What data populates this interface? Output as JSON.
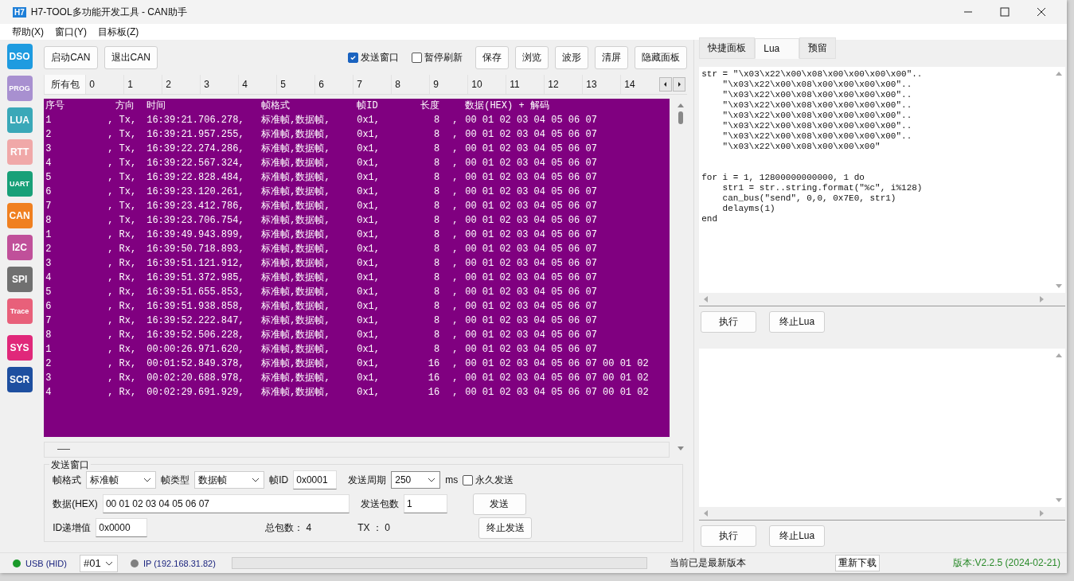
{
  "window": {
    "title": "H7-TOOL多功能开发工具 - CAN助手",
    "logo": "H7"
  },
  "menu": [
    "帮助(X)",
    "窗口(Y)",
    "目标板(Z)"
  ],
  "sidebar": [
    {
      "label": "DSO",
      "color": "#1e9be0"
    },
    {
      "label": "PROG",
      "color": "#a890d0"
    },
    {
      "label": "LUA",
      "color": "#3aa8b8"
    },
    {
      "label": "RTT",
      "color": "#f0a8a8"
    },
    {
      "label": "UART",
      "color": "#18a078"
    },
    {
      "label": "CAN",
      "color": "#f08020"
    },
    {
      "label": "I2C",
      "color": "#c0509a"
    },
    {
      "label": "SPI",
      "color": "#707070"
    },
    {
      "label": "Trace",
      "color": "#e8607a"
    },
    {
      "label": "SYS",
      "color": "#e0287a"
    },
    {
      "label": "SCR",
      "color": "#1e4fa0"
    }
  ],
  "toolbar": {
    "left_buttons": [
      "启动CAN",
      "退出CAN"
    ],
    "checkboxes": [
      {
        "label": "发送窗口",
        "checked": true
      },
      {
        "label": "暂停刷新",
        "checked": false
      }
    ],
    "right_buttons": [
      "保存",
      "浏览",
      "波形",
      "清屏",
      "隐藏面板"
    ]
  },
  "channel_tabs": [
    {
      "label": "所有包",
      "selected": true
    },
    {
      "label": "0",
      "selected": false
    },
    {
      "label": "1",
      "selected": false
    },
    {
      "label": "2",
      "selected": false
    },
    {
      "label": "3",
      "selected": false
    },
    {
      "label": "4",
      "selected": false
    },
    {
      "label": "5",
      "selected": false
    },
    {
      "label": "6",
      "selected": false
    },
    {
      "label": "7",
      "selected": false
    },
    {
      "label": "8",
      "selected": false
    },
    {
      "label": "9",
      "selected": false
    },
    {
      "label": "10",
      "selected": false
    },
    {
      "label": "11",
      "selected": false
    },
    {
      "label": "12",
      "selected": false
    },
    {
      "label": "13",
      "selected": false
    },
    {
      "label": "14",
      "selected": false
    }
  ],
  "log": {
    "columns": [
      "序号",
      "方向",
      "时间",
      "帧格式",
      "帧ID",
      "长度",
      "数据(HEX) + 解码"
    ],
    "rows": [
      {
        "seq": "1",
        "dir": ", Tx,",
        "time": "16:39:21.706.278,",
        "format": "标准帧,数据帧,",
        "id": "0x1,",
        "len": "8",
        "sep": ",",
        "data": "00 01 02 03 04 05 06 07"
      },
      {
        "seq": "2",
        "dir": ", Tx,",
        "time": "16:39:21.957.255,",
        "format": "标准帧,数据帧,",
        "id": "0x1,",
        "len": "8",
        "sep": ",",
        "data": "00 01 02 03 04 05 06 07"
      },
      {
        "seq": "3",
        "dir": ", Tx,",
        "time": "16:39:22.274.286,",
        "format": "标准帧,数据帧,",
        "id": "0x1,",
        "len": "8",
        "sep": ",",
        "data": "00 01 02 03 04 05 06 07"
      },
      {
        "seq": "4",
        "dir": ", Tx,",
        "time": "16:39:22.567.324,",
        "format": "标准帧,数据帧,",
        "id": "0x1,",
        "len": "8",
        "sep": ",",
        "data": "00 01 02 03 04 05 06 07"
      },
      {
        "seq": "5",
        "dir": ", Tx,",
        "time": "16:39:22.828.484,",
        "format": "标准帧,数据帧,",
        "id": "0x1,",
        "len": "8",
        "sep": ",",
        "data": "00 01 02 03 04 05 06 07"
      },
      {
        "seq": "6",
        "dir": ", Tx,",
        "time": "16:39:23.120.261,",
        "format": "标准帧,数据帧,",
        "id": "0x1,",
        "len": "8",
        "sep": ",",
        "data": "00 01 02 03 04 05 06 07"
      },
      {
        "seq": "7",
        "dir": ", Tx,",
        "time": "16:39:23.412.786,",
        "format": "标准帧,数据帧,",
        "id": "0x1,",
        "len": "8",
        "sep": ",",
        "data": "00 01 02 03 04 05 06 07"
      },
      {
        "seq": "8",
        "dir": ", Tx,",
        "time": "16:39:23.706.754,",
        "format": "标准帧,数据帧,",
        "id": "0x1,",
        "len": "8",
        "sep": ",",
        "data": "00 01 02 03 04 05 06 07"
      },
      {
        "seq": "1",
        "dir": ", Rx,",
        "time": "16:39:49.943.899,",
        "format": "标准帧,数据帧,",
        "id": "0x1,",
        "len": "8",
        "sep": ",",
        "data": "00 01 02 03 04 05 06 07"
      },
      {
        "seq": "2",
        "dir": ", Rx,",
        "time": "16:39:50.718.893,",
        "format": "标准帧,数据帧,",
        "id": "0x1,",
        "len": "8",
        "sep": ",",
        "data": "00 01 02 03 04 05 06 07"
      },
      {
        "seq": "3",
        "dir": ", Rx,",
        "time": "16:39:51.121.912,",
        "format": "标准帧,数据帧,",
        "id": "0x1,",
        "len": "8",
        "sep": ",",
        "data": "00 01 02 03 04 05 06 07"
      },
      {
        "seq": "4",
        "dir": ", Rx,",
        "time": "16:39:51.372.985,",
        "format": "标准帧,数据帧,",
        "id": "0x1,",
        "len": "8",
        "sep": ",",
        "data": "00 01 02 03 04 05 06 07"
      },
      {
        "seq": "5",
        "dir": ", Rx,",
        "time": "16:39:51.655.853,",
        "format": "标准帧,数据帧,",
        "id": "0x1,",
        "len": "8",
        "sep": ",",
        "data": "00 01 02 03 04 05 06 07"
      },
      {
        "seq": "6",
        "dir": ", Rx,",
        "time": "16:39:51.938.858,",
        "format": "标准帧,数据帧,",
        "id": "0x1,",
        "len": "8",
        "sep": ",",
        "data": "00 01 02 03 04 05 06 07"
      },
      {
        "seq": "7",
        "dir": ", Rx,",
        "time": "16:39:52.222.847,",
        "format": "标准帧,数据帧,",
        "id": "0x1,",
        "len": "8",
        "sep": ",",
        "data": "00 01 02 03 04 05 06 07"
      },
      {
        "seq": "8",
        "dir": ", Rx,",
        "time": "16:39:52.506.228,",
        "format": "标准帧,数据帧,",
        "id": "0x1,",
        "len": "8",
        "sep": ",",
        "data": "00 01 02 03 04 05 06 07"
      },
      {
        "seq": "1",
        "dir": ", Rx,",
        "time": "00:00:26.971.620,",
        "format": "标准帧,数据帧,",
        "id": "0x1,",
        "len": "8",
        "sep": ",",
        "data": "00 01 02 03 04 05 06 07"
      },
      {
        "seq": "2",
        "dir": ", Rx,",
        "time": "00:01:52.849.378,",
        "format": "标准帧,数据帧,",
        "id": "0x1,",
        "len": "16",
        "sep": ",",
        "data": "00 01 02 03 04 05 06 07 00 01 02"
      },
      {
        "seq": "3",
        "dir": ", Rx,",
        "time": "00:02:20.688.978,",
        "format": "标准帧,数据帧,",
        "id": "0x1,",
        "len": "16",
        "sep": ",",
        "data": "00 01 02 03 04 05 06 07 00 01 02"
      },
      {
        "seq": "4",
        "dir": ", Rx,",
        "time": "00:02:29.691.929,",
        "format": "标准帧,数据帧,",
        "id": "0x1,",
        "len": "16",
        "sep": ",",
        "data": "00 01 02 03 04 05 06 07 00 01 02"
      }
    ]
  },
  "send_window": {
    "title": "发送窗口",
    "frame_format": {
      "label": "帧格式",
      "value": "标准帧"
    },
    "frame_type": {
      "label": "帧类型",
      "value": "数据帧"
    },
    "frame_id": {
      "label": "帧ID",
      "value": "0x0001"
    },
    "period": {
      "label": "发送周期",
      "value": "250",
      "unit": "ms"
    },
    "forever": {
      "label": "永久发送",
      "checked": false
    },
    "data": {
      "label": "数据(HEX)",
      "value": "00 01 02 03 04 05 06 07"
    },
    "count": {
      "label": "发送包数",
      "value": "1"
    },
    "buttons": [
      "发送",
      "终止发送"
    ],
    "id_increment": {
      "label": "ID递增值",
      "value": "0x0000"
    },
    "total": "总包数： 4",
    "tx": "TX ： 0"
  },
  "right_tabs": [
    {
      "label": "快捷面板",
      "selected": false
    },
    {
      "label": "Lua",
      "selected": true
    },
    {
      "label": "预留",
      "selected": false
    }
  ],
  "lua_code": [
    {
      "lines": [
        "str = \"\\x03\\x22\\x00\\x08\\x00\\x00\\x00\\x00\"..",
        "    \"\\x03\\x22\\x00\\x08\\x00\\x00\\x00\\x00\"..",
        "    \"\\x03\\x22\\x00\\x08\\x00\\x00\\x00\\x00\"..",
        "    \"\\x03\\x22\\x00\\x08\\x00\\x00\\x00\\x00\"..",
        "    \"\\x03\\x22\\x00\\x08\\x00\\x00\\x00\\x00\"..",
        "    \"\\x03\\x22\\x00\\x08\\x00\\x00\\x00\\x00\"..",
        "    \"\\x03\\x22\\x00\\x08\\x00\\x00\\x00\\x00\"..",
        "    \"\\x03\\x22\\x00\\x08\\x00\\x00\\x00\""
      ]
    },
    {
      "lines": [
        "for i = 1, 12800000000000, 1 do",
        "    str1 = str..string.format(\"%c\", i%128)",
        "    can_bus(\"send\", 0,0, 0x7E0, str1)",
        "    delayms(1)",
        "end"
      ]
    }
  ],
  "lua_buttons": [
    "执行",
    "终止Lua"
  ],
  "output_buttons": [
    "执行",
    "终止Lua"
  ],
  "status_bar": {
    "usb": {
      "label": "USB (HID)",
      "color": "#1a9a2a"
    },
    "port": "#01",
    "ip": {
      "label": "IP (192.168.31.82)",
      "color": "#808080"
    },
    "progress": {
      "level": 0
    },
    "message": "当前已是最新版本",
    "redownload": "重新下载",
    "version": "版本:V2.2.5 (2024-02-21)"
  }
}
